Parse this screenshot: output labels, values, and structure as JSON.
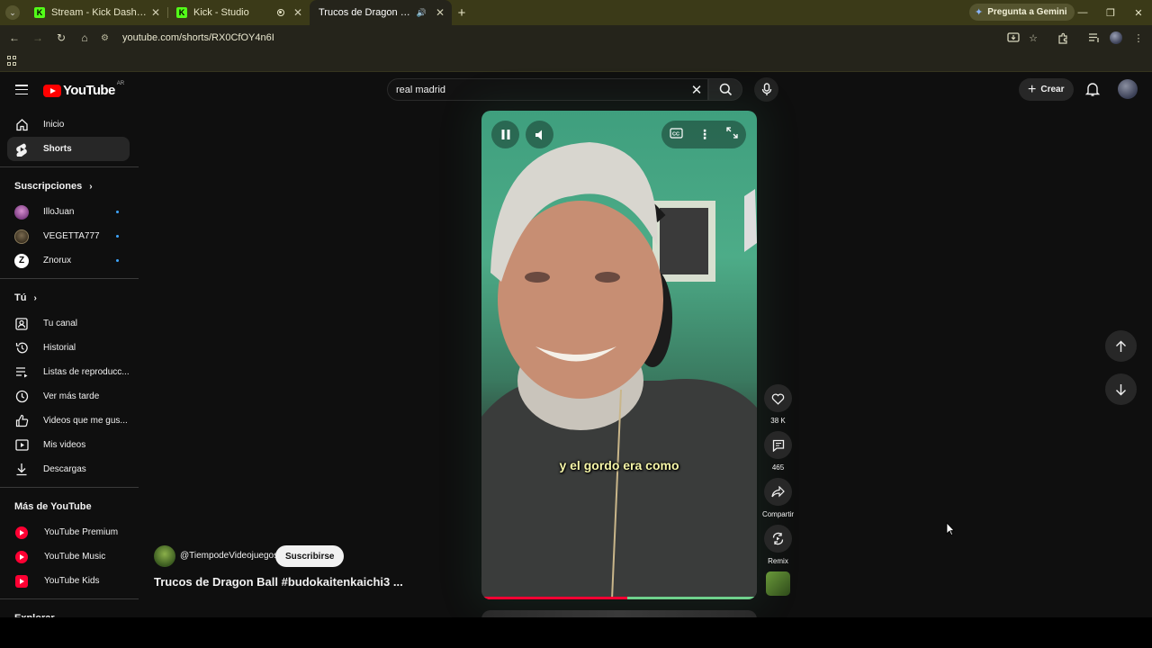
{
  "browser": {
    "tabs": [
      {
        "title": "Stream - Kick Dashboard",
        "favicon": "kick-icon"
      },
      {
        "title": "Kick - Studio",
        "favicon": "kick-icon"
      },
      {
        "title": "Trucos de Dragon Ball #bud",
        "favicon": "youtube-icon",
        "active": true
      }
    ],
    "gemini_label": "Pregunta a Gemini",
    "url": "youtube.com/shorts/RX0CfOY4n6I"
  },
  "youtube": {
    "logo_text": "YouTube",
    "country_code": "AR",
    "search": {
      "query": "real madrid"
    },
    "create_label": "Crear",
    "sidebar": {
      "main": [
        {
          "label": "Inicio",
          "icon": "home-icon"
        },
        {
          "label": "Shorts",
          "icon": "shorts-icon",
          "active": true
        }
      ],
      "subscriptions_title": "Suscripciones",
      "subscriptions": [
        {
          "label": "IlloJuan",
          "color": "#b07ab8"
        },
        {
          "label": "VEGETTA777",
          "color": "#5a4a3a"
        },
        {
          "label": "Znorux",
          "color": "#ffffff"
        }
      ],
      "you_title": "Tú",
      "you": [
        {
          "label": "Tu canal",
          "icon": "channel-icon"
        },
        {
          "label": "Historial",
          "icon": "history-icon"
        },
        {
          "label": "Listas de reproducc...",
          "icon": "playlist-icon"
        },
        {
          "label": "Ver más tarde",
          "icon": "clock-icon"
        },
        {
          "label": "Videos que me gus...",
          "icon": "thumbs-up-icon"
        },
        {
          "label": "Mis videos",
          "icon": "my-videos-icon"
        },
        {
          "label": "Descargas",
          "icon": "download-icon"
        }
      ],
      "more_title": "Más de YouTube",
      "more": [
        {
          "label": "YouTube Premium"
        },
        {
          "label": "YouTube Music"
        },
        {
          "label": "YouTube Kids"
        }
      ],
      "explore_title": "Explorar"
    },
    "short": {
      "caption": "y el gordo era como",
      "progress": 0.53,
      "channel": "@TiempodeVideojuegos",
      "subscribe_label": "Suscribirse",
      "title": "Trucos de Dragon Ball #budokaitenkaichi3 ...",
      "likes": "38 K",
      "comments": "465",
      "share_label": "Compartir",
      "remix_label": "Remix"
    }
  }
}
